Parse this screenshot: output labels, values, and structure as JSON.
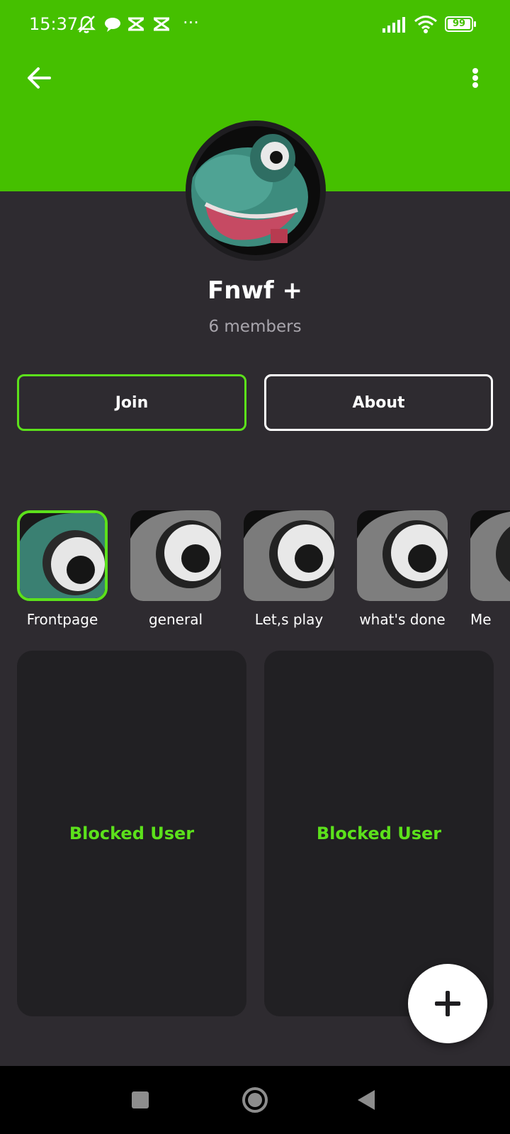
{
  "status_bar": {
    "time": "15:37",
    "battery": "99",
    "more_dots": "···"
  },
  "header": {
    "bg_color": "#45c000",
    "back_icon": "arrow-left-icon",
    "more_icon": "vertical-dots-icon"
  },
  "community": {
    "name": "Fnwf +",
    "members": "6 members"
  },
  "actions": {
    "join_label": "Join",
    "about_label": "About"
  },
  "channels": [
    {
      "label": "Frontpage",
      "selected": true
    },
    {
      "label": "general",
      "selected": false
    },
    {
      "label": "Let,s play",
      "selected": false
    },
    {
      "label": "what's done",
      "selected": false
    },
    {
      "label": "Me",
      "selected": false
    }
  ],
  "posts": [
    {
      "label": "Blocked User"
    },
    {
      "label": "Blocked User"
    }
  ],
  "fab": {
    "icon": "plus-icon"
  },
  "colors": {
    "accent": "#5ce11b",
    "background": "#2e2b30",
    "card": "#212023"
  }
}
